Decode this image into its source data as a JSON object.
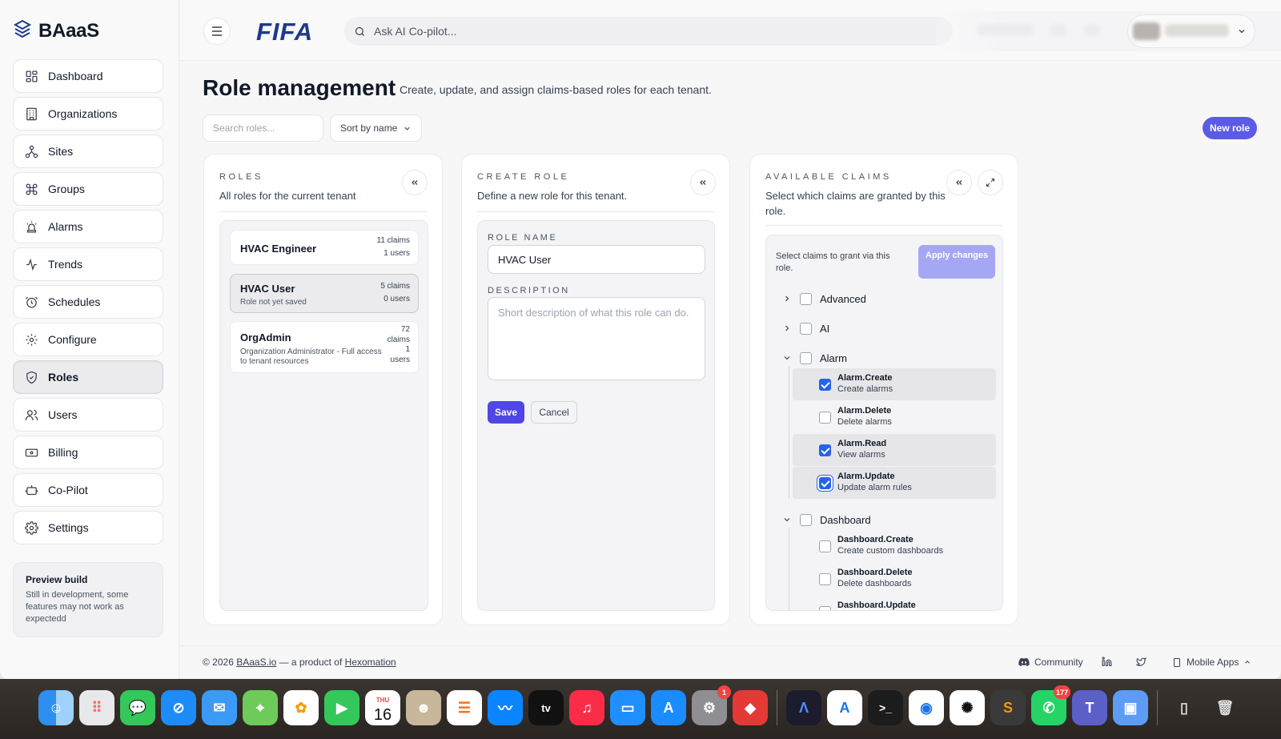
{
  "sidebar": {
    "brand": "BAaaS",
    "items": [
      {
        "label": "Dashboard",
        "icon": "dashboard-icon"
      },
      {
        "label": "Organizations",
        "icon": "building-icon"
      },
      {
        "label": "Sites",
        "icon": "sites-icon"
      },
      {
        "label": "Groups",
        "icon": "command-icon"
      },
      {
        "label": "Alarms",
        "icon": "siren-icon"
      },
      {
        "label": "Trends",
        "icon": "trend-icon"
      },
      {
        "label": "Schedules",
        "icon": "alarm-clock-icon"
      },
      {
        "label": "Configure",
        "icon": "gear-icon"
      },
      {
        "label": "Roles",
        "icon": "shield-icon",
        "active": true
      },
      {
        "label": "Users",
        "icon": "users-icon"
      },
      {
        "label": "Billing",
        "icon": "billing-icon"
      },
      {
        "label": "Co-Pilot",
        "icon": "bot-icon"
      },
      {
        "label": "Settings",
        "icon": "settings-icon"
      }
    ],
    "preview": {
      "title": "Preview build",
      "text": "Still in development, some features may not work as expectedd"
    }
  },
  "topbar": {
    "logo": "FIFA",
    "search_placeholder": "Ask AI Co-pilot..."
  },
  "page": {
    "title": "Role management",
    "subtitle": "Create, update, and assign claims-based roles for each tenant.",
    "search_placeholder": "Search roles...",
    "sort_label": "Sort by name",
    "new_role": "New role"
  },
  "roles_panel": {
    "eyebrow": "ROLES",
    "desc": "All roles for the current tenant",
    "roles": [
      {
        "name": "HVAC Engineer",
        "sub": "",
        "claims": "11 claims",
        "users": "1 users"
      },
      {
        "name": "HVAC User",
        "sub": "Role not yet saved",
        "claims": "5 claims",
        "users": "0 users"
      },
      {
        "name": "OrgAdmin",
        "sub": "Organization Administrator - Full access to tenant resources",
        "claims": "72 claims",
        "users": "1 users"
      }
    ]
  },
  "create_panel": {
    "eyebrow": "CREATE ROLE",
    "desc": "Define a new role for this tenant.",
    "role_name_label": "ROLE NAME",
    "role_name_value": "HVAC User",
    "description_label": "DESCRIPTION",
    "description_placeholder": "Short description of what this role can do.",
    "save": "Save",
    "cancel": "Cancel"
  },
  "claims_panel": {
    "eyebrow": "AVAILABLE CLAIMS",
    "desc": "Select which claims are granted by this role.",
    "hint": "Select claims to grant via this role.",
    "apply": "Apply changes",
    "groups": {
      "advanced": "Advanced",
      "ai": "AI",
      "alarm": "Alarm",
      "dashboard": "Dashboard"
    },
    "alarm_claims": [
      {
        "name": "Alarm.Create",
        "desc": "Create alarms",
        "checked": true
      },
      {
        "name": "Alarm.Delete",
        "desc": "Delete alarms",
        "checked": false
      },
      {
        "name": "Alarm.Read",
        "desc": "View alarms",
        "checked": true
      },
      {
        "name": "Alarm.Update",
        "desc": "Update alarm rules",
        "checked": true
      }
    ],
    "dashboard_claims": [
      {
        "name": "Dashboard.Create",
        "desc": "Create custom dashboards",
        "checked": false
      },
      {
        "name": "Dashboard.Delete",
        "desc": "Delete dashboards",
        "checked": false
      },
      {
        "name": "Dashboard.Update",
        "desc": "",
        "checked": false
      }
    ]
  },
  "footer": {
    "copy_prefix": "© 2026 ",
    "link1": "BAaaS.io",
    "copy_mid": " — a product of ",
    "link2": "Hexomation",
    "community": "Community",
    "mobile_apps": "Mobile Apps"
  },
  "dock": {
    "calendar_month": "THU",
    "calendar_day": "16",
    "settings_badge": "1",
    "whatsapp_badge": "177"
  },
  "colors": {
    "accent": "#5b5be6",
    "checkbox": "#2563eb",
    "apply_disabled": "#a5a7f5"
  }
}
